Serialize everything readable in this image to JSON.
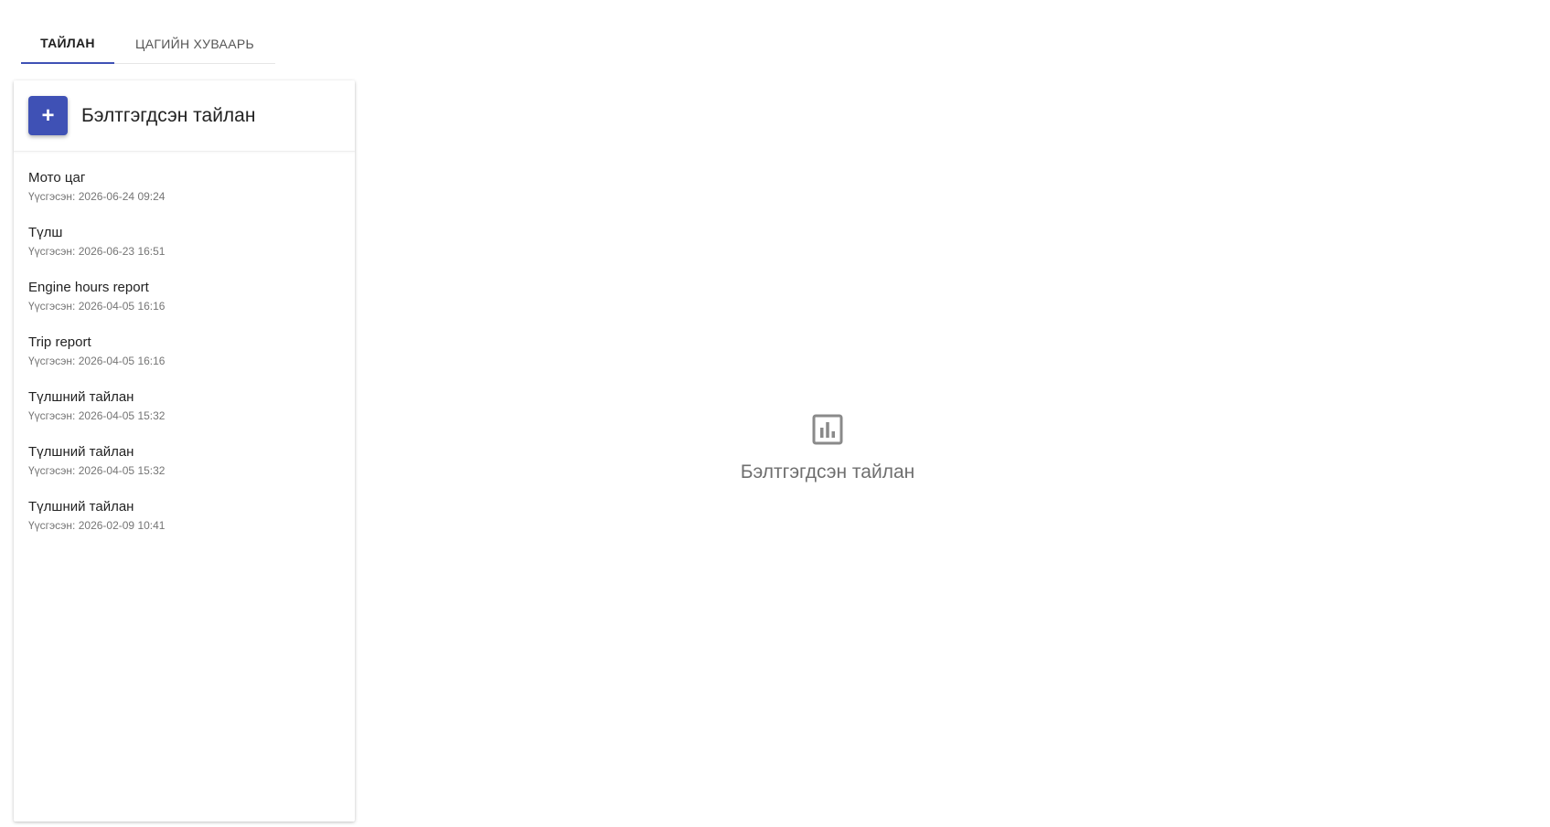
{
  "tabs": [
    {
      "label": "ТАЙЛАН",
      "active": true
    },
    {
      "label": "ЦАГИЙН ХУВААРЬ",
      "active": false
    }
  ],
  "sidebar": {
    "add_button_label": "+",
    "title": "Бэлтгэгдсэн тайлан",
    "items": [
      {
        "name": "Мото цаг",
        "created": "Үүсгэсэн: 2026-06-24 09:24"
      },
      {
        "name": "Түлш",
        "created": "Үүсгэсэн: 2026-06-23 16:51"
      },
      {
        "name": "Engine hours report",
        "created": "Үүсгэсэн: 2026-04-05 16:16"
      },
      {
        "name": "Trip report",
        "created": "Үүсгэсэн: 2026-04-05 16:16"
      },
      {
        "name": "Түлшний тайлан",
        "created": "Үүсгэсэн: 2026-04-05 15:32"
      },
      {
        "name": "Түлшний тайлан",
        "created": "Үүсгэсэн: 2026-04-05 15:32"
      },
      {
        "name": "Түлшний тайлан",
        "created": "Үүсгэсэн: 2026-02-09 10:41"
      }
    ]
  },
  "empty_state": {
    "icon": "bar-chart-icon",
    "text": "Бэлтгэгдсэн тайлан"
  },
  "colors": {
    "accent": "#3f51b5",
    "muted_text": "#757575",
    "icon_gray": "#8a8a8a"
  }
}
